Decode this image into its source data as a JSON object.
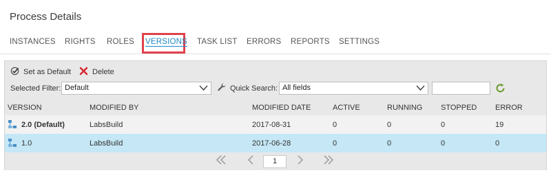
{
  "page": {
    "title": "Process Details"
  },
  "tabs": [
    {
      "label": "INSTANCES"
    },
    {
      "label": "RIGHTS"
    },
    {
      "label": "ROLES"
    },
    {
      "label": "VERSIONS"
    },
    {
      "label": "TASK LIST"
    },
    {
      "label": "ERRORS"
    },
    {
      "label": "REPORTS"
    },
    {
      "label": "SETTINGS"
    }
  ],
  "toolbar": {
    "set_default_label": "Set as Default",
    "delete_label": "Delete"
  },
  "filter": {
    "selected_filter_label": "Selected Filter:",
    "selected_filter_value": "Default",
    "quick_search_label": "Quick Search:",
    "quick_search_scope": "All fields",
    "quick_search_text": ""
  },
  "grid": {
    "columns": [
      "VERSION",
      "MODIFIED BY",
      "MODIFIED DATE",
      "ACTIVE",
      "RUNNING",
      "STOPPED",
      "ERROR"
    ],
    "rows": [
      {
        "version": "2.0 (Default)",
        "modified_by": "LabsBuild",
        "modified_date": "2017-08-31",
        "active": "0",
        "running": "0",
        "stopped": "0",
        "error": "19"
      },
      {
        "version": "1.0",
        "modified_by": "LabsBuild",
        "modified_date": "2017-06-28",
        "active": "0",
        "running": "0",
        "stopped": "0",
        "error": "0"
      }
    ]
  },
  "pager": {
    "current_page": "1"
  },
  "colors": {
    "accent": "#1e88c8",
    "highlight": "#e0414b",
    "selected_row": "#c5e7f6",
    "delete": "#d9252e",
    "refresh": "#6a9a2a"
  }
}
